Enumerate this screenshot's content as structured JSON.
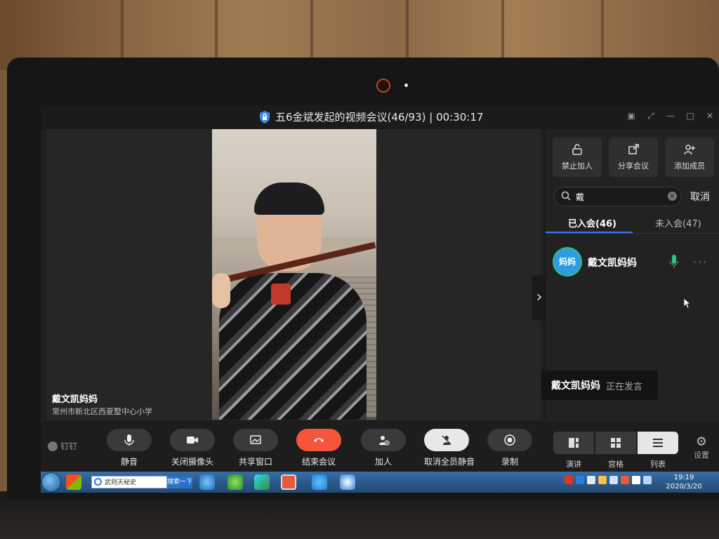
{
  "window": {
    "title": "五6金斌发起的视频会议(46/93) | 00:30:17"
  },
  "speaker": {
    "name": "戴文凯妈妈",
    "org": "常州市新北区西夏墅中心小学"
  },
  "panel": {
    "tools": [
      {
        "label": "禁止加人",
        "icon": "lock-icon"
      },
      {
        "label": "分享会议",
        "icon": "share-icon"
      },
      {
        "label": "添加成员",
        "icon": "add-user-icon"
      }
    ],
    "search": {
      "value": "戴"
    },
    "cancel_label": "取消",
    "tabs": {
      "joined": "已入会(46)",
      "not_joined": "未入会(47)"
    },
    "member": {
      "avatar_text": "妈妈",
      "name": "戴文凯妈妈",
      "more": "···"
    },
    "toast": {
      "name": "戴文凯妈妈",
      "status": "正在发言"
    }
  },
  "toolbar": {
    "brand": "钉钉",
    "mute": "静音",
    "camera_off": "关闭摄像头",
    "share_window": "共享窗口",
    "end_meeting": "结束会议",
    "add_person": "加人",
    "unmute_all": "取消全员静音",
    "record": "录制",
    "layouts": {
      "speech": "演讲",
      "grid": "宫格",
      "list": "列表"
    },
    "settings": "设置"
  },
  "taskbar": {
    "address_text": "武则天秘史",
    "search_button": "搜索一下",
    "time": "19:19",
    "date": "2020/3/20"
  },
  "colors": {
    "end_button": "#f5563b",
    "active_tab_underline": "#3e7bf6",
    "mic_active": "#2ec27e"
  }
}
